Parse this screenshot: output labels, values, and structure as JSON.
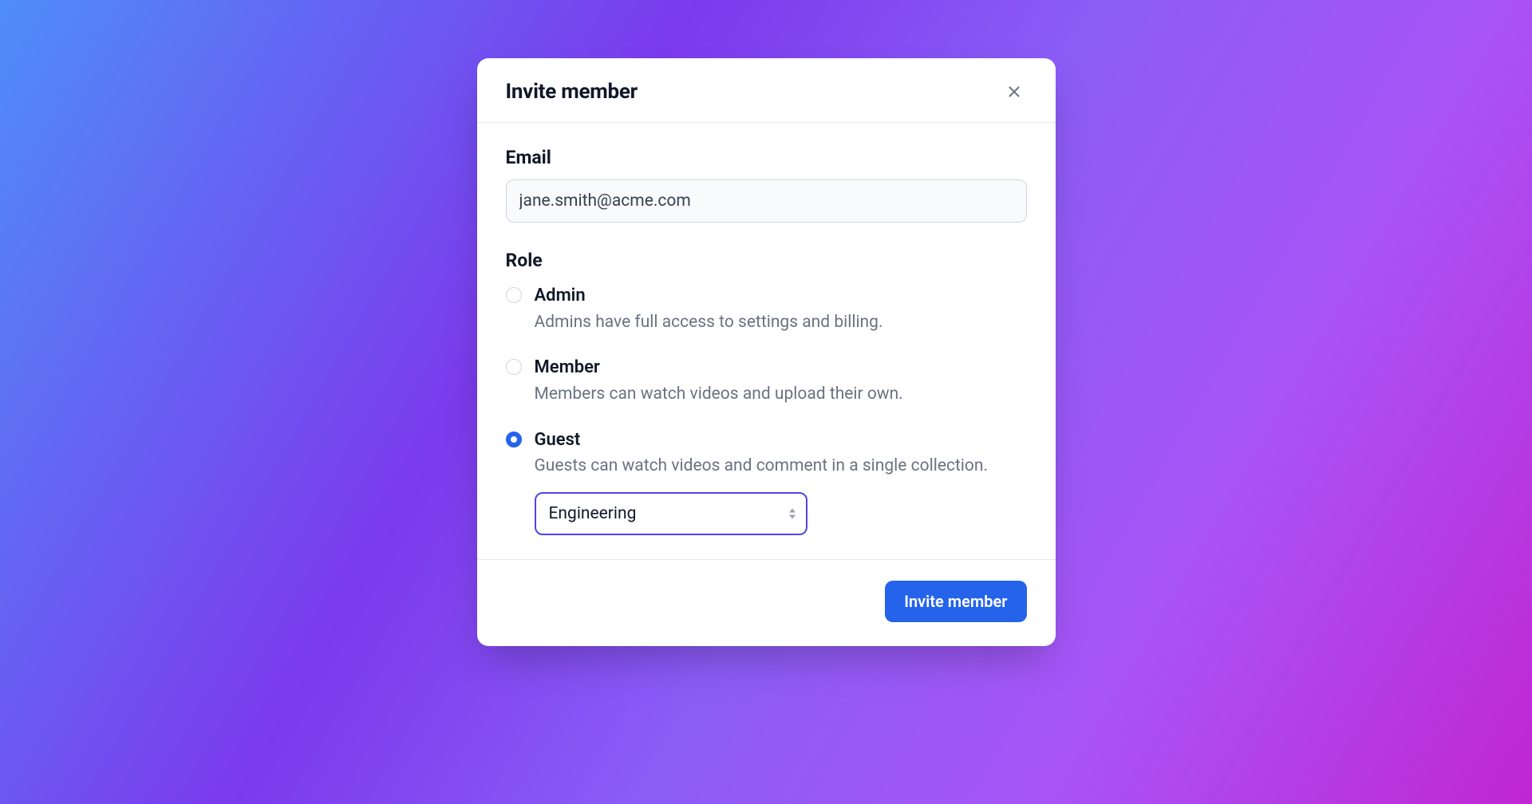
{
  "modal": {
    "title": "Invite member",
    "email": {
      "label": "Email",
      "value": "jane.smith@acme.com"
    },
    "role": {
      "label": "Role",
      "selected": "guest",
      "options": [
        {
          "id": "admin",
          "label": "Admin",
          "description": "Admins have full access to settings and billing."
        },
        {
          "id": "member",
          "label": "Member",
          "description": "Members can watch videos and upload their own."
        },
        {
          "id": "guest",
          "label": "Guest",
          "description": "Guests can watch videos and comment in a single collection."
        }
      ],
      "collection": {
        "selected": "Engineering"
      }
    },
    "submit_label": "Invite member"
  }
}
